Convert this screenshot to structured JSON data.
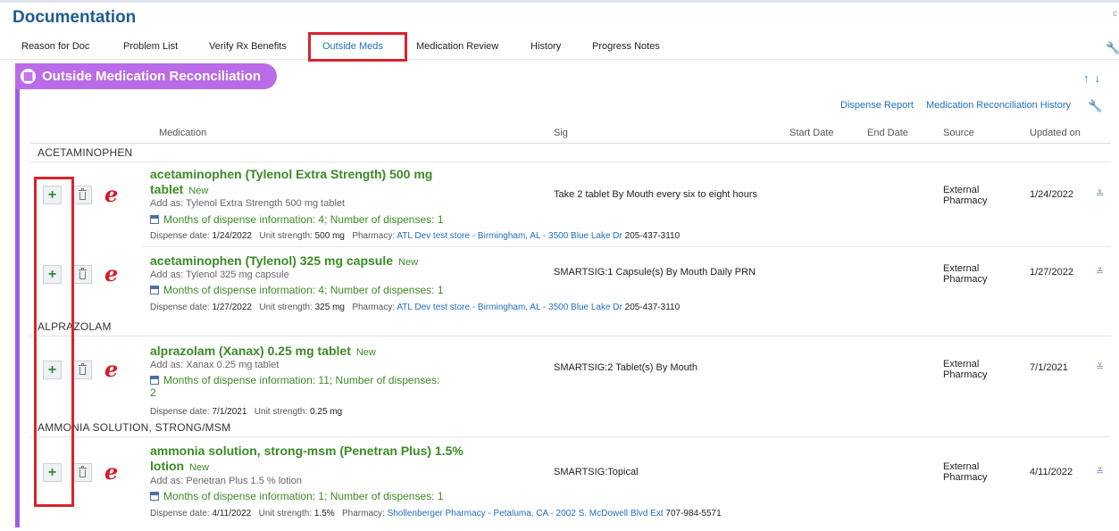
{
  "page": {
    "title": "Documentation",
    "corner_mark": "c"
  },
  "tabs": [
    "Reason for Doc",
    "Problem List",
    "Verify Rx Benefits",
    "Outside Meds",
    "Medication Review",
    "History",
    "Progress Notes"
  ],
  "panel": {
    "title": "Outside Medication Reconciliation",
    "dispense_report": "Dispense Report",
    "reconciliation_history": "Medication Reconciliation History",
    "columns": {
      "medication": "Medication",
      "sig": "Sig",
      "start": "Start Date",
      "end": "End Date",
      "source": "Source",
      "updated": "Updated on"
    }
  },
  "groups": [
    "ACETAMINOPHEN",
    "ALPRAZOLAM",
    "AMMONIA SOLUTION, STRONG/MSM"
  ],
  "meds": [
    {
      "name_line1": "acetaminophen (Tylenol Extra Strength) 500 mg",
      "name_line2": "tablet",
      "status": "New",
      "add_as": "Add as: Tylenol Extra Strength 500 mg tablet",
      "months": "Months of dispense information: 4; Number of dispenses: 1",
      "dispense_label": "Dispense date:",
      "dispense_date": "1/24/2022",
      "strength_label": "Unit strength:",
      "strength": "500 mg",
      "pharmacy_label": "Pharmacy:",
      "pharmacy": "ATL Dev test store - Birmingham, AL - 3500 Blue Lake Dr",
      "phone": "205-437-3110",
      "sig": "Take 2 tablet By Mouth every six to eight hours",
      "source_line1": "External",
      "source_line2": "Pharmacy",
      "updated": "1/24/2022"
    },
    {
      "name_line1": "acetaminophen (Tylenol) 325 mg capsule",
      "status": "New",
      "add_as": "Add as: Tylenol 325 mg capsule",
      "months": "Months of dispense information: 4; Number of dispenses: 1",
      "dispense_label": "Dispense date:",
      "dispense_date": "1/27/2022",
      "strength_label": "Unit strength:",
      "strength": "325 mg",
      "pharmacy_label": "Pharmacy:",
      "pharmacy": "ATL Dev test store - Birmingham, AL - 3500 Blue Lake Dr",
      "phone": "205-437-3110",
      "sig": "SMARTSIG:1 Capsule(s) By Mouth Daily PRN",
      "source_line1": "External",
      "source_line2": "Pharmacy",
      "updated": "1/27/2022"
    },
    {
      "name_line1": "alprazolam (Xanax) 0.25 mg tablet",
      "status": "New",
      "add_as": "Add as: Xanax 0.25 mg tablet",
      "months": "Months of dispense information: 11; Number of dispenses:",
      "months_line2": "2",
      "dispense_label": "Dispense date:",
      "dispense_date": "7/1/2021",
      "strength_label": "Unit strength:",
      "strength": "0.25 mg",
      "sig": "SMARTSIG:2 Tablet(s) By Mouth",
      "source_line1": "External",
      "source_line2": "Pharmacy",
      "updated": "7/1/2021"
    },
    {
      "name_line1": "ammonia solution, strong-msm (Penetran Plus) 1.5%",
      "name_line2": "lotion",
      "status": "New",
      "add_as": "Add as: Penetran Plus 1.5 % lotion",
      "months": "Months of dispense information: 1; Number of dispenses: 1",
      "dispense_label": "Dispense date:",
      "dispense_date": "4/11/2022",
      "strength_label": "Unit strength:",
      "strength": "1.5%",
      "pharmacy_label": "Pharmacy:",
      "pharmacy": "Shollenberger Pharmacy - Petaluma, CA - 2002 S. McDowell Blvd Ext",
      "phone": "707-984-5571",
      "sig": "SMARTSIG:Topical",
      "source_line1": "External",
      "source_line2": "Pharmacy",
      "updated": "4/11/2022"
    }
  ],
  "icons": {
    "add": "plus-icon",
    "delete": "trash-icon",
    "eprescribe": "e-icon",
    "expand": "chevron-double-down-icon",
    "settings": "wrench-icon",
    "sort": "up-down-arrows-icon"
  },
  "colors": {
    "title": "#1e5b96",
    "panel": "#b96be8",
    "drug": "#3b8a25",
    "highlight": "#d9232e",
    "link": "#1f6fbf"
  }
}
